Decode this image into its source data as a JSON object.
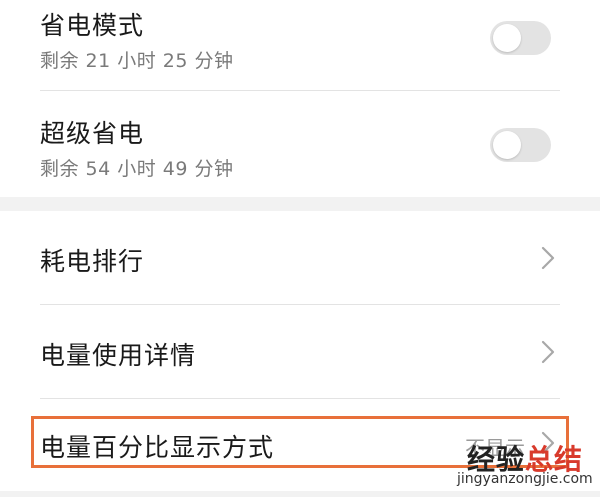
{
  "power_modes": [
    {
      "title": "省电模式",
      "remaining": "剩余 21 小时 25 分钟",
      "enabled": false
    },
    {
      "title": "超级省电",
      "remaining": "剩余 54 小时 49 分钟",
      "enabled": false
    }
  ],
  "menu": [
    {
      "label": "耗电排行",
      "icon": "chevron-right-icon"
    },
    {
      "label": "电量使用详情",
      "icon": "chevron-right-icon"
    },
    {
      "label": "电量百分比显示方式",
      "value": "不显示",
      "icon": "chevron-right-icon"
    }
  ],
  "watermark": {
    "cn_text_dark": "经验",
    "cn_text_red": "总结",
    "en_text": "jingyanzongjie.com"
  },
  "colors": {
    "highlight": "#e8703a",
    "toggle_off": "#e3e3e3",
    "text_primary": "#1a1a1a",
    "text_secondary": "#7a7a7a",
    "background": "#f2f2f2"
  }
}
